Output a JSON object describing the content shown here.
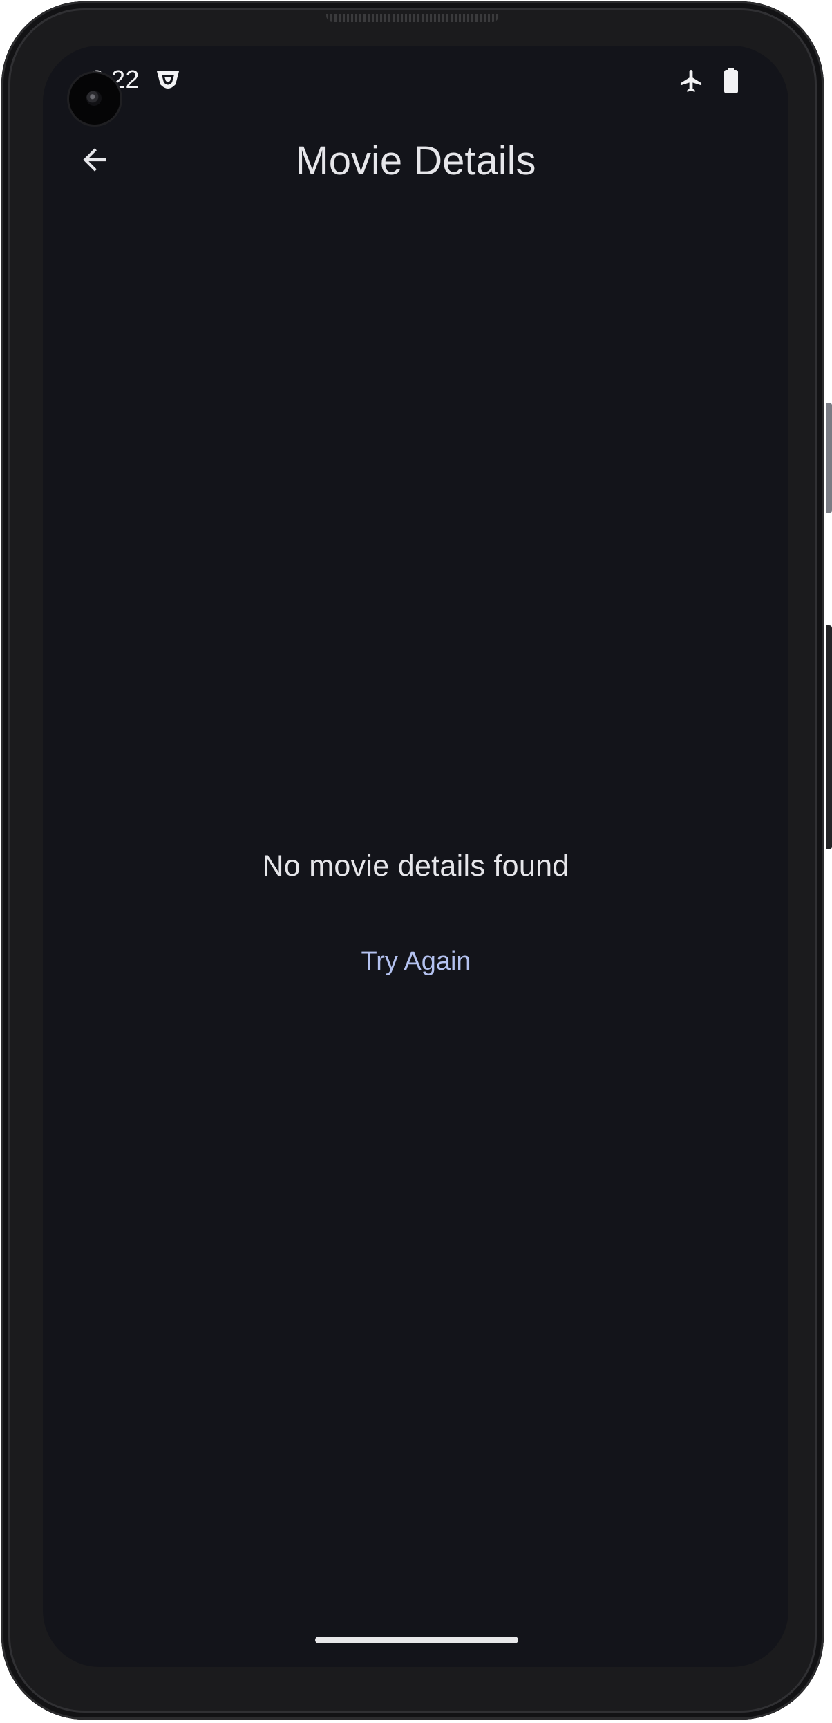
{
  "status_bar": {
    "time": "2:22",
    "left_icon": "shield-icon",
    "right_icons": [
      "airplane-mode-icon",
      "battery-icon"
    ]
  },
  "app_bar": {
    "back_icon": "arrow-back-icon",
    "title": "Movie Details"
  },
  "content": {
    "empty_message": "No movie details found",
    "retry_label": "Try Again"
  },
  "colors": {
    "background": "#13141a",
    "text_primary": "#e6e6ea",
    "accent": "#b4c2f0"
  }
}
